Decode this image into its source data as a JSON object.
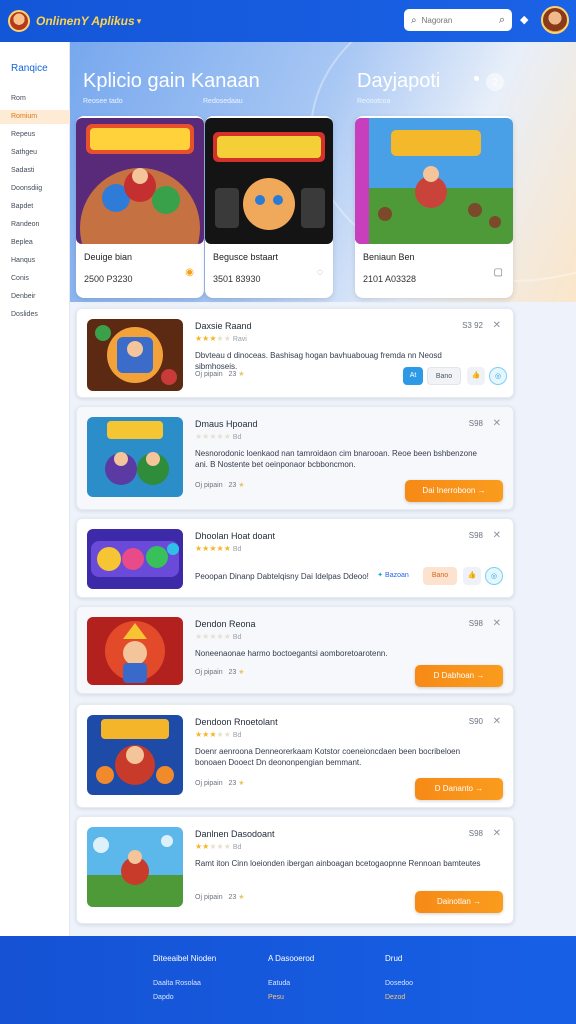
{
  "header": {
    "brand": "OnlinenY Aplikus",
    "search_placeholder": "Nagoran",
    "search_icon": "search-icon",
    "bell_icon": "bell-icon"
  },
  "sidebar": {
    "title": "Ranqice",
    "items": [
      {
        "label": "Rom"
      },
      {
        "label": "Romium",
        "active": true
      },
      {
        "label": "Repeus"
      },
      {
        "label": "Sathgeu"
      },
      {
        "label": "Sadasti"
      },
      {
        "label": "Doonsdiig"
      },
      {
        "label": "Bapdet"
      },
      {
        "label": "Randeon"
      },
      {
        "label": "Beplea"
      },
      {
        "label": "Hanqus"
      },
      {
        "label": "Conis"
      },
      {
        "label": "Denbeir"
      },
      {
        "label": "Doslides"
      }
    ]
  },
  "hero": {
    "title_left": "Kplicio gain Kanaan",
    "title_right": "Dayjapoti",
    "sub1": "Reosee tado",
    "sub2": "Redosedaau",
    "sub3": "Reosotcoa",
    "dot_label": "2"
  },
  "featured": [
    {
      "name": "Deuige bian",
      "meta": "2500 P3230",
      "icon": "coin-icon",
      "glyph": "◉",
      "color": "#f59e0b"
    },
    {
      "name": "Begusce bstaart",
      "meta": "3501 83930",
      "icon": "timer-icon",
      "glyph": "◌",
      "color": "#9aa0a8"
    },
    {
      "name": "Beniaun Ben",
      "meta": "2101 A03328",
      "icon": "square-icon",
      "glyph": "▢",
      "color": "#6b7280"
    }
  ],
  "rows": [
    {
      "name": "Daxsie Raand",
      "price": "S3 92",
      "stars": 3,
      "count": "Ravi",
      "desc": "Dbvteau d dinoceas. Bashisag hogan bavhuabouag fremda nn Neosd sibmhoseis.",
      "foot": "Oj pipain",
      "foot_num": "23",
      "actions": [
        "At",
        "Bano"
      ]
    },
    {
      "name": "Dmaus Hpoand",
      "price": "S98",
      "stars": 0,
      "count": "Bd",
      "desc": "Nesnorodonic loenkaod nan tamroidaon cim bnarooan. Reoe been bshbenzone ani. B Nostente bet oeinponaor bcbboncmon.",
      "foot": "Oj pipain",
      "foot_num": "23",
      "button": "Dai Inerroboon"
    },
    {
      "name": "Dhoolan Hoat doant",
      "price": "S98",
      "stars": 5,
      "count": "Bd",
      "desc": "Peoopan Dinanp Dabtelqisny Dai Idelpas Ddeoo!",
      "pill": "Bazoan",
      "actions2": [
        "Bano"
      ]
    },
    {
      "name": "Dendon Reona",
      "price": "S98",
      "stars": 0,
      "count": "Bd",
      "desc": "Noneenaonae harmo boctoegantsi aomboretoarotenn.",
      "foot": "Oj pipain",
      "foot_num": "23",
      "button": "D Dabhoan"
    },
    {
      "name": "Dendoon Rnoetolant",
      "price": "S90",
      "stars": 3,
      "count": "Bd",
      "desc": "Doenr aenroona Denneorerkaam Kotstor coeneioncdaen been bocribeloen bonoaen Dooect Dn deononpengian bemmant.",
      "foot": "Oj pipain",
      "foot_num": "23",
      "button": "D Dananto"
    },
    {
      "name": "Danlnen Dasodoant",
      "price": "S98",
      "stars": 2,
      "count": "Bd",
      "desc": "Ramt iton Cinn loeionden ibergan ainboagan bcetogaopnne Rennoan bamteutes",
      "foot": "Oj pipain",
      "foot_num": "23",
      "button": "Dainotlan"
    }
  ],
  "footer": {
    "col1": {
      "title": "Diteeaibel Nioden",
      "links": [
        "Daalta Rosolaa",
        "Dapdo"
      ]
    },
    "col2": {
      "title": "A Dasooerod",
      "links": [
        "Eatuda",
        "Pesu"
      ]
    },
    "col3": {
      "title": "Drud",
      "links": [
        "Dosedoo",
        "Dezod"
      ]
    }
  },
  "colors": {
    "accent": "#1565d8",
    "orange": "#f68a16",
    "star": "#f3b628"
  }
}
